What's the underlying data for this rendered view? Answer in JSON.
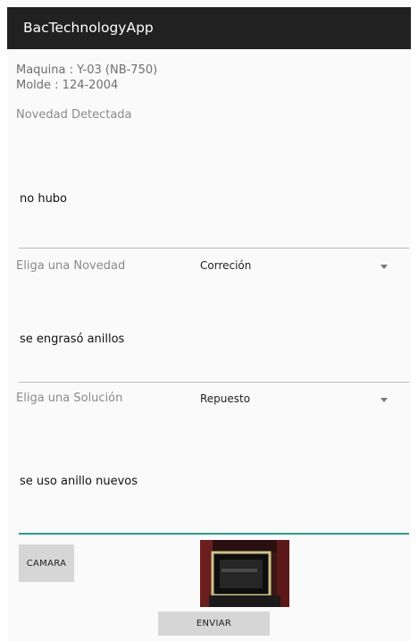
{
  "app": {
    "title": "BacTechnologyApp"
  },
  "machine": {
    "maquina": "Maquina : Y-03 (NB-750)",
    "molde": "Molde : 124-2004"
  },
  "section_label": "Novedad Detectada",
  "fields": {
    "novedad_text": "no hubo",
    "novedad_label": "Eliga una Novedad",
    "novedad_selected": "Correción",
    "accion_text": "se engrasó anillos",
    "solucion_label": "Eliga una Solución",
    "solucion_selected": "Repuesto",
    "solucion_text": "se uso anillo nuevos"
  },
  "buttons": {
    "camera": "CAMARA",
    "send": "ENVIAR"
  },
  "icons": {
    "spinner_arrow": "caret-down-icon"
  },
  "colors": {
    "appbar": "#212121",
    "focus_underline": "#2a9d8f",
    "button": "#d6d6d6"
  }
}
